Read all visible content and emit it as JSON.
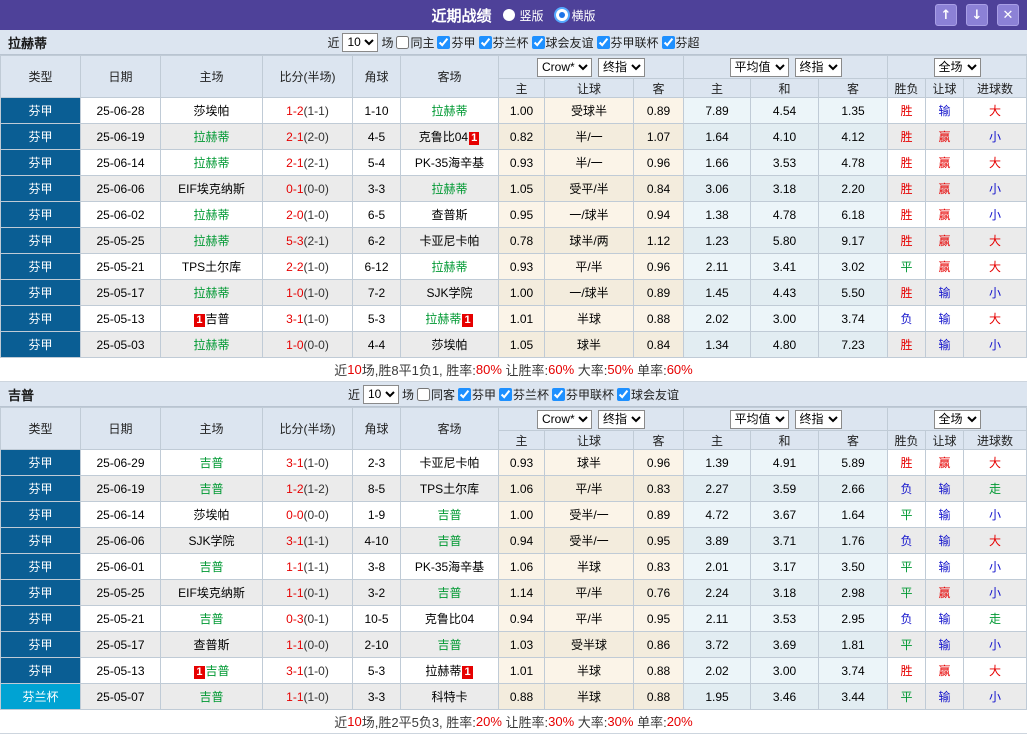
{
  "header": {
    "title": "近期战绩",
    "radios": [
      {
        "label": "竖版",
        "checked": false
      },
      {
        "label": "横版",
        "checked": true
      }
    ],
    "icons": {
      "up": "↑",
      "down": "↓",
      "close": "✕"
    }
  },
  "columns": {
    "left": [
      "类型",
      "日期",
      "主场",
      "比分(半场)",
      "角球",
      "客场"
    ],
    "sub": [
      "主",
      "让球",
      "客",
      "主",
      "和",
      "客",
      "胜负",
      "让球",
      "进球数"
    ],
    "selects": {
      "crow": "Crow*",
      "final": "终指",
      "average": "平均值",
      "final2": "终指",
      "scope": "全场"
    }
  },
  "colors": {
    "titlebar_purple": "#4e4199",
    "type_league_blue": "#0a5e94",
    "type_cup_cyan": "#00a3d3",
    "team_highlight_green": "#009933",
    "win_red": "#e60000",
    "lose_blue": "#1414cc",
    "draw_green": "#009933"
  },
  "semantics": {
    "胜": "red",
    "负": "blue",
    "平": "green",
    "赢": "red",
    "输": "blue",
    "走": "green",
    "大": "red",
    "小": "blue"
  },
  "sections": [
    {
      "team": "拉赫蒂",
      "filter": {
        "prefix": "近",
        "count": "10",
        "suffix": "场",
        "same": {
          "label": "同主",
          "checked": false
        },
        "leagues": [
          {
            "label": "芬甲",
            "checked": true
          },
          {
            "label": "芬兰杯",
            "checked": true
          },
          {
            "label": "球会友谊",
            "checked": true
          },
          {
            "label": "芬甲联杯",
            "checked": true
          },
          {
            "label": "芬超",
            "checked": true
          }
        ]
      },
      "rows": [
        {
          "type": "芬甲",
          "cup": false,
          "date": "25-06-28",
          "home": "莎埃帕",
          "home_hl": false,
          "home_badge": null,
          "score": "1-2",
          "half": "(1-1)",
          "corner": "1-10",
          "away": "拉赫蒂",
          "away_hl": true,
          "away_badge": null,
          "odds": [
            "1.00",
            "受球半",
            "0.89"
          ],
          "avg": [
            "7.89",
            "4.54",
            "1.35"
          ],
          "results": [
            "胜",
            "输",
            "大"
          ]
        },
        {
          "type": "芬甲",
          "cup": false,
          "date": "25-06-19",
          "home": "拉赫蒂",
          "home_hl": true,
          "home_badge": null,
          "score": "2-1",
          "half": "(2-0)",
          "corner": "4-5",
          "away": "克鲁比04",
          "away_hl": false,
          "away_badge": "1",
          "odds": [
            "0.82",
            "半/一",
            "1.07"
          ],
          "avg": [
            "1.64",
            "4.10",
            "4.12"
          ],
          "results": [
            "胜",
            "赢",
            "小"
          ]
        },
        {
          "type": "芬甲",
          "cup": false,
          "date": "25-06-14",
          "home": "拉赫蒂",
          "home_hl": true,
          "home_badge": null,
          "score": "2-1",
          "half": "(2-1)",
          "corner": "5-4",
          "away": "PK-35海辛基",
          "away_hl": false,
          "away_badge": null,
          "odds": [
            "0.93",
            "半/一",
            "0.96"
          ],
          "avg": [
            "1.66",
            "3.53",
            "4.78"
          ],
          "results": [
            "胜",
            "赢",
            "大"
          ]
        },
        {
          "type": "芬甲",
          "cup": false,
          "date": "25-06-06",
          "home": "EIF埃克纳斯",
          "home_hl": false,
          "home_badge": null,
          "score": "0-1",
          "half": "(0-0)",
          "corner": "3-3",
          "away": "拉赫蒂",
          "away_hl": true,
          "away_badge": null,
          "odds": [
            "1.05",
            "受平/半",
            "0.84"
          ],
          "avg": [
            "3.06",
            "3.18",
            "2.20"
          ],
          "results": [
            "胜",
            "赢",
            "小"
          ]
        },
        {
          "type": "芬甲",
          "cup": false,
          "date": "25-06-02",
          "home": "拉赫蒂",
          "home_hl": true,
          "home_badge": null,
          "score": "2-0",
          "half": "(1-0)",
          "corner": "6-5",
          "away": "查普斯",
          "away_hl": false,
          "away_badge": null,
          "odds": [
            "0.95",
            "一/球半",
            "0.94"
          ],
          "avg": [
            "1.38",
            "4.78",
            "6.18"
          ],
          "results": [
            "胜",
            "赢",
            "小"
          ]
        },
        {
          "type": "芬甲",
          "cup": false,
          "date": "25-05-25",
          "home": "拉赫蒂",
          "home_hl": true,
          "home_badge": null,
          "score": "5-3",
          "half": "(2-1)",
          "corner": "6-2",
          "away": "卡亚尼卡帕",
          "away_hl": false,
          "away_badge": null,
          "odds": [
            "0.78",
            "球半/两",
            "1.12"
          ],
          "avg": [
            "1.23",
            "5.80",
            "9.17"
          ],
          "results": [
            "胜",
            "赢",
            "大"
          ]
        },
        {
          "type": "芬甲",
          "cup": false,
          "date": "25-05-21",
          "home": "TPS土尔库",
          "home_hl": false,
          "home_badge": null,
          "score": "2-2",
          "half": "(1-0)",
          "corner": "6-12",
          "away": "拉赫蒂",
          "away_hl": true,
          "away_badge": null,
          "odds": [
            "0.93",
            "平/半",
            "0.96"
          ],
          "avg": [
            "2.11",
            "3.41",
            "3.02"
          ],
          "results": [
            "平",
            "赢",
            "大"
          ]
        },
        {
          "type": "芬甲",
          "cup": false,
          "date": "25-05-17",
          "home": "拉赫蒂",
          "home_hl": true,
          "home_badge": null,
          "score": "1-0",
          "half": "(1-0)",
          "corner": "7-2",
          "away": "SJK学院",
          "away_hl": false,
          "away_badge": null,
          "odds": [
            "1.00",
            "一/球半",
            "0.89"
          ],
          "avg": [
            "1.45",
            "4.43",
            "5.50"
          ],
          "results": [
            "胜",
            "输",
            "小"
          ]
        },
        {
          "type": "芬甲",
          "cup": false,
          "date": "25-05-13",
          "home": "吉普",
          "home_hl": false,
          "home_badge": "1",
          "score": "3-1",
          "half": "(1-0)",
          "corner": "5-3",
          "away": "拉赫蒂",
          "away_hl": true,
          "away_badge": "1",
          "odds": [
            "1.01",
            "半球",
            "0.88"
          ],
          "avg": [
            "2.02",
            "3.00",
            "3.74"
          ],
          "results": [
            "负",
            "输",
            "大"
          ]
        },
        {
          "type": "芬甲",
          "cup": false,
          "date": "25-05-03",
          "home": "拉赫蒂",
          "home_hl": true,
          "home_badge": null,
          "score": "1-0",
          "half": "(0-0)",
          "corner": "4-4",
          "away": "莎埃帕",
          "away_hl": false,
          "away_badge": null,
          "odds": [
            "1.05",
            "球半",
            "0.84"
          ],
          "avg": [
            "1.34",
            "4.80",
            "7.23"
          ],
          "results": [
            "胜",
            "输",
            "小"
          ]
        }
      ],
      "summary": [
        [
          "近",
          false
        ],
        [
          "10",
          true
        ],
        [
          "场,胜8平1负1, 胜率:",
          false
        ],
        [
          "80%",
          true
        ],
        [
          " 让胜率:",
          false
        ],
        [
          "60%",
          true
        ],
        [
          " 大率:",
          false
        ],
        [
          "50%",
          true
        ],
        [
          " 单率:",
          false
        ],
        [
          "60%",
          true
        ]
      ]
    },
    {
      "team": "吉普",
      "filter": {
        "prefix": "近",
        "count": "10",
        "suffix": "场",
        "same": {
          "label": "同客",
          "checked": false
        },
        "leagues": [
          {
            "label": "芬甲",
            "checked": true
          },
          {
            "label": "芬兰杯",
            "checked": true
          },
          {
            "label": "芬甲联杯",
            "checked": true
          },
          {
            "label": "球会友谊",
            "checked": true
          }
        ]
      },
      "rows": [
        {
          "type": "芬甲",
          "cup": false,
          "date": "25-06-29",
          "home": "吉普",
          "home_hl": true,
          "home_badge": null,
          "score": "3-1",
          "half": "(1-0)",
          "corner": "2-3",
          "away": "卡亚尼卡帕",
          "away_hl": false,
          "away_badge": null,
          "odds": [
            "0.93",
            "球半",
            "0.96"
          ],
          "avg": [
            "1.39",
            "4.91",
            "5.89"
          ],
          "results": [
            "胜",
            "赢",
            "大"
          ]
        },
        {
          "type": "芬甲",
          "cup": false,
          "date": "25-06-19",
          "home": "吉普",
          "home_hl": true,
          "home_badge": null,
          "score": "1-2",
          "half": "(1-2)",
          "corner": "8-5",
          "away": "TPS土尔库",
          "away_hl": false,
          "away_badge": null,
          "odds": [
            "1.06",
            "平/半",
            "0.83"
          ],
          "avg": [
            "2.27",
            "3.59",
            "2.66"
          ],
          "results": [
            "负",
            "输",
            "走"
          ]
        },
        {
          "type": "芬甲",
          "cup": false,
          "date": "25-06-14",
          "home": "莎埃帕",
          "home_hl": false,
          "home_badge": null,
          "score": "0-0",
          "half": "(0-0)",
          "corner": "1-9",
          "away": "吉普",
          "away_hl": true,
          "away_badge": null,
          "odds": [
            "1.00",
            "受半/一",
            "0.89"
          ],
          "avg": [
            "4.72",
            "3.67",
            "1.64"
          ],
          "results": [
            "平",
            "输",
            "小"
          ]
        },
        {
          "type": "芬甲",
          "cup": false,
          "date": "25-06-06",
          "home": "SJK学院",
          "home_hl": false,
          "home_badge": null,
          "score": "3-1",
          "half": "(1-1)",
          "corner": "4-10",
          "away": "吉普",
          "away_hl": true,
          "away_badge": null,
          "odds": [
            "0.94",
            "受半/一",
            "0.95"
          ],
          "avg": [
            "3.89",
            "3.71",
            "1.76"
          ],
          "results": [
            "负",
            "输",
            "大"
          ]
        },
        {
          "type": "芬甲",
          "cup": false,
          "date": "25-06-01",
          "home": "吉普",
          "home_hl": true,
          "home_badge": null,
          "score": "1-1",
          "half": "(1-1)",
          "corner": "3-8",
          "away": "PK-35海辛基",
          "away_hl": false,
          "away_badge": null,
          "odds": [
            "1.06",
            "半球",
            "0.83"
          ],
          "avg": [
            "2.01",
            "3.17",
            "3.50"
          ],
          "results": [
            "平",
            "输",
            "小"
          ]
        },
        {
          "type": "芬甲",
          "cup": false,
          "date": "25-05-25",
          "home": "EIF埃克纳斯",
          "home_hl": false,
          "home_badge": null,
          "score": "1-1",
          "half": "(0-1)",
          "corner": "3-2",
          "away": "吉普",
          "away_hl": true,
          "away_badge": null,
          "odds": [
            "1.14",
            "平/半",
            "0.76"
          ],
          "avg": [
            "2.24",
            "3.18",
            "2.98"
          ],
          "results": [
            "平",
            "赢",
            "小"
          ]
        },
        {
          "type": "芬甲",
          "cup": false,
          "date": "25-05-21",
          "home": "吉普",
          "home_hl": true,
          "home_badge": null,
          "score": "0-3",
          "half": "(0-1)",
          "corner": "10-5",
          "away": "克鲁比04",
          "away_hl": false,
          "away_badge": null,
          "odds": [
            "0.94",
            "平/半",
            "0.95"
          ],
          "avg": [
            "2.11",
            "3.53",
            "2.95"
          ],
          "results": [
            "负",
            "输",
            "走"
          ]
        },
        {
          "type": "芬甲",
          "cup": false,
          "date": "25-05-17",
          "home": "查普斯",
          "home_hl": false,
          "home_badge": null,
          "score": "1-1",
          "half": "(0-0)",
          "corner": "2-10",
          "away": "吉普",
          "away_hl": true,
          "away_badge": null,
          "odds": [
            "1.03",
            "受半球",
            "0.86"
          ],
          "avg": [
            "3.72",
            "3.69",
            "1.81"
          ],
          "results": [
            "平",
            "输",
            "小"
          ]
        },
        {
          "type": "芬甲",
          "cup": false,
          "date": "25-05-13",
          "home": "吉普",
          "home_hl": true,
          "home_badge": "1",
          "score": "3-1",
          "half": "(1-0)",
          "corner": "5-3",
          "away": "拉赫蒂",
          "away_hl": false,
          "away_badge": "1",
          "odds": [
            "1.01",
            "半球",
            "0.88"
          ],
          "avg": [
            "2.02",
            "3.00",
            "3.74"
          ],
          "results": [
            "胜",
            "赢",
            "大"
          ]
        },
        {
          "type": "芬兰杯",
          "cup": true,
          "date": "25-05-07",
          "home": "吉普",
          "home_hl": true,
          "home_badge": null,
          "score": "1-1",
          "half": "(1-0)",
          "corner": "3-3",
          "away": "科特卡",
          "away_hl": false,
          "away_badge": null,
          "odds": [
            "0.88",
            "半球",
            "0.88"
          ],
          "avg": [
            "1.95",
            "3.46",
            "3.44"
          ],
          "results": [
            "平",
            "输",
            "小"
          ]
        }
      ],
      "summary": [
        [
          "近",
          false
        ],
        [
          "10",
          true
        ],
        [
          "场,胜2平5负3, 胜率:",
          false
        ],
        [
          "20%",
          true
        ],
        [
          " 让胜率:",
          false
        ],
        [
          "30%",
          true
        ],
        [
          " 大率:",
          false
        ],
        [
          "30%",
          true
        ],
        [
          " 单率:",
          false
        ],
        [
          "20%",
          true
        ]
      ]
    }
  ]
}
